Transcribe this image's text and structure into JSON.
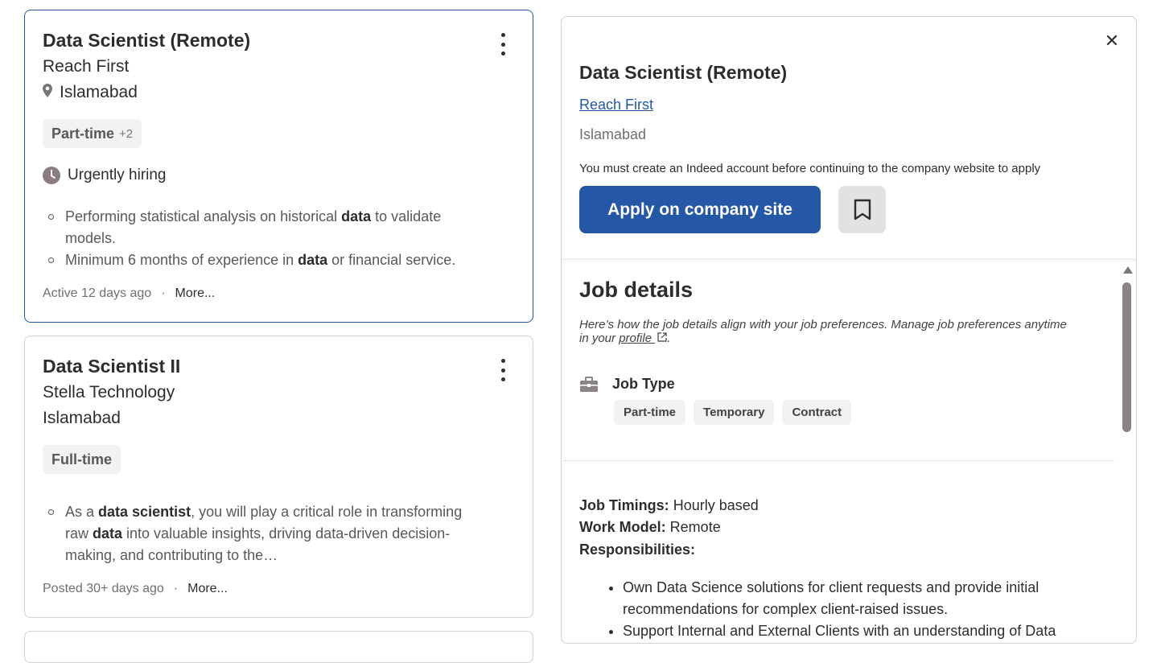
{
  "job_cards": [
    {
      "title": "Data Scientist (Remote)",
      "company": "Reach First",
      "location": "Islamabad",
      "tag": "Part-time",
      "tag_more": "+2",
      "urgent": "Urgently hiring",
      "snippet_1_pre": "Performing statistical analysis on historical ",
      "snippet_1_bold": "data",
      "snippet_1_post": " to validate",
      "snippet_1_line2": "models.",
      "snippet_2_pre": "Minimum 6 months of experience in ",
      "snippet_2_bold": "data",
      "snippet_2_post": " or financial service.",
      "meta": "Active 12 days ago",
      "more": "More..."
    },
    {
      "title": "Data Scientist II",
      "company": "Stella Technology",
      "location": "Islamabad",
      "tag": "Full-time",
      "snippet_a": "As a ",
      "snippet_b": "data scientist",
      "snippet_c": ", you will play a critical role in transforming",
      "snippet_d": "raw ",
      "snippet_e": "data",
      "snippet_f": " into valuable insights, driving data-driven decision-",
      "snippet_g": "making, and contributing to the…",
      "meta": "Posted 30+ days ago",
      "more": "More..."
    }
  ],
  "detail": {
    "title": "Data Scientist (Remote)",
    "company": "Reach First",
    "location": "Islamabad",
    "notice": "You must create an Indeed account before continuing to the company website to apply",
    "apply_label": "Apply on company site",
    "job_details_heading": "Job details",
    "pref_text": "Here’s how the job details align with your job preferences. Manage job preferences anytime in your ",
    "pref_link": "profile",
    "job_type_label": "Job Type",
    "job_types": [
      "Part-time",
      "Temporary",
      "Contract"
    ],
    "timings_label": "Job Timings:",
    "timings_value": " Hourly based",
    "model_label": "Work Model:",
    "model_value": " Remote",
    "responsibilities_heading": "Responsibilities:",
    "responsibilities": [
      "Own Data Science solutions for client requests and provide initial recommendations for complex client-raised issues.",
      "Support Internal and External Clients with an understanding of Data"
    ]
  },
  "colors": {
    "accent": "#2557a7",
    "selected_border": "#2557a7",
    "tag_bg": "#f3f2f1"
  },
  "icons": [
    "kebab-menu-icon",
    "location-pin-icon",
    "clock-icon",
    "close-icon",
    "bookmark-icon",
    "briefcase-icon",
    "external-link-icon"
  ]
}
